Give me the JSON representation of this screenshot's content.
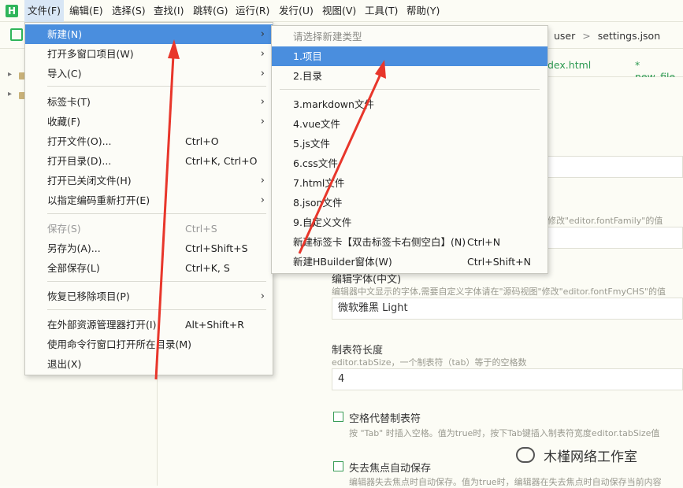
{
  "app_icon_letter": "H",
  "menubar": [
    "文件(F)",
    "编辑(E)",
    "选择(S)",
    "查找(I)",
    "跳转(G)",
    "运行(R)",
    "发行(U)",
    "视图(V)",
    "工具(T)",
    "帮助(Y)"
  ],
  "breadcrumb": {
    "item1": "user",
    "item2": "settings.json"
  },
  "tabs": {
    "tab1": "dex.html",
    "tab2": "* new_file."
  },
  "file_menu": {
    "items": [
      {
        "label": "新建(N)",
        "shortcut": "",
        "submenu": true
      },
      {
        "label": "打开多窗口项目(W)",
        "shortcut": "",
        "submenu": true
      },
      {
        "label": "导入(C)",
        "shortcut": "",
        "submenu": true
      },
      {
        "label": "标签卡(T)",
        "shortcut": "",
        "submenu": true
      },
      {
        "label": "收藏(F)",
        "shortcut": "",
        "submenu": true
      },
      {
        "label": "打开文件(O)...",
        "shortcut": "Ctrl+O",
        "submenu": false
      },
      {
        "label": "打开目录(D)...",
        "shortcut": "Ctrl+K, Ctrl+O",
        "submenu": false
      },
      {
        "label": "打开已关闭文件(H)",
        "shortcut": "",
        "submenu": true
      },
      {
        "label": "以指定编码重新打开(E)",
        "shortcut": "",
        "submenu": true
      },
      {
        "label": "保存(S)",
        "shortcut": "Ctrl+S",
        "submenu": false
      },
      {
        "label": "另存为(A)...",
        "shortcut": "Ctrl+Shift+S",
        "submenu": false
      },
      {
        "label": "全部保存(L)",
        "shortcut": "Ctrl+K, S",
        "submenu": false
      },
      {
        "label": "恢复已移除项目(P)",
        "shortcut": "",
        "submenu": true
      },
      {
        "label": "在外部资源管理器打开(I)",
        "shortcut": "Alt+Shift+R",
        "submenu": false
      },
      {
        "label": "使用命令行窗口打开所在目录(M)",
        "shortcut": "",
        "submenu": false
      },
      {
        "label": "退出(X)",
        "shortcut": "",
        "submenu": false
      }
    ]
  },
  "new_submenu": {
    "header": "请选择新建类型",
    "items": [
      {
        "label": "1.项目",
        "shortcut": ""
      },
      {
        "label": "2.目录",
        "shortcut": ""
      },
      {
        "label": "3.markdown文件",
        "shortcut": ""
      },
      {
        "label": "4.vue文件",
        "shortcut": ""
      },
      {
        "label": "5.js文件",
        "shortcut": ""
      },
      {
        "label": "6.css文件",
        "shortcut": ""
      },
      {
        "label": "7.html文件",
        "shortcut": ""
      },
      {
        "label": "8.json文件",
        "shortcut": ""
      },
      {
        "label": "9.自定义文件",
        "shortcut": ""
      },
      {
        "label": "新建标签卡【双击标签卡右侧空白】(N)",
        "shortcut": "Ctrl+N"
      },
      {
        "label": "新建HBuilder窗体(W)",
        "shortcut": "Ctrl+Shift+N"
      }
    ]
  },
  "settings": {
    "font_desc_fragment": "图\"修改\"editor.fontFamily\"的值",
    "cn_font_title": "编辑字体(中文)",
    "cn_font_desc": "编辑器中文显示的字体,需要自定义字体请在\"源码视图\"修改\"editor.fontFmyCHS\"的值",
    "cn_font_value": "微软雅黑 Light",
    "tab_size_title": "制表符长度",
    "tab_size_desc": "editor.tabSize，一个制表符（tab）等于的空格数",
    "tab_size_value": "4",
    "spaces_title": "空格代替制表符",
    "spaces_desc": "按 \"Tab\" 时插入空格。值为true时，按下Tab键插入制表符宽度editor.tabSize值",
    "autosave_title": "失去焦点自动保存",
    "autosave_desc": "编辑器失去焦点时自动保存。值为true时，编辑器在失去焦点时自动保存当前内容"
  },
  "watermark": "木槿网络工作室",
  "colors": {
    "highlight": "#4a8ede",
    "accent": "#2fb55a",
    "arrow": "#e8362b"
  }
}
